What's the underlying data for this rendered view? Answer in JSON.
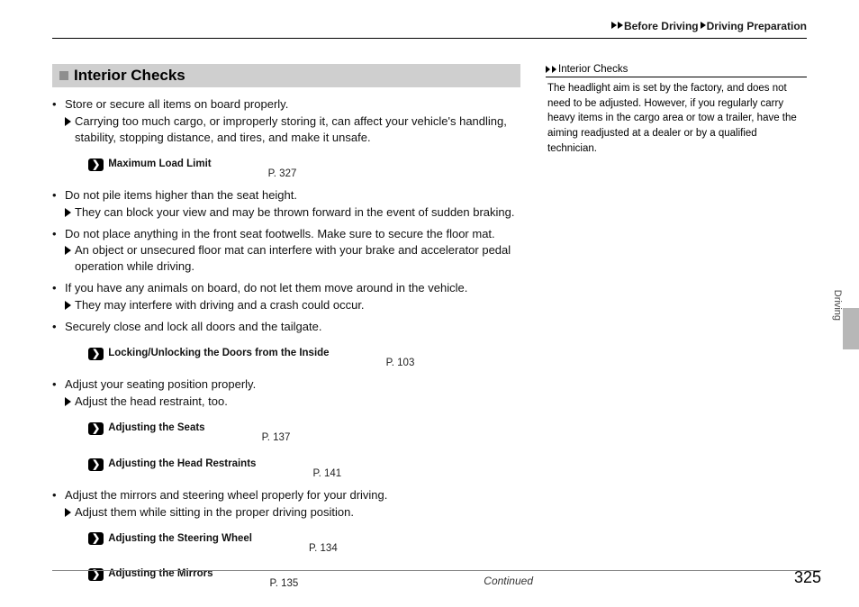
{
  "breadcrumb": {
    "a": "Before Driving",
    "b": "Driving Preparation"
  },
  "tabLabel": "Driving",
  "section": {
    "title": "Interior Checks"
  },
  "bullets": [
    {
      "text": "Store or secure all items on board properly.",
      "sub": "Carrying too much cargo, or improperly storing it, can affect your vehicle's handling, stability, stopping distance, and tires, and make it unsafe.",
      "xrefs": [
        {
          "title": "Maximum Load Limit",
          "page": "P. 327"
        }
      ]
    },
    {
      "text": "Do not pile items higher than the seat height.",
      "sub": "They can block your view and may be thrown forward in the event of sudden braking."
    },
    {
      "text": "Do not place anything in the front seat footwells. Make sure to secure the floor mat.",
      "sub": "An object or unsecured floor mat can interfere with your brake and accelerator pedal operation while driving."
    },
    {
      "text": "If you have any animals on board, do not let them move around in the vehicle.",
      "sub": "They may interfere with driving and a crash could occur."
    },
    {
      "text": "Securely close and lock all doors and the tailgate.",
      "xrefs": [
        {
          "title": "Locking/Unlocking the Doors from the Inside",
          "page": "P. 103"
        }
      ]
    },
    {
      "text": "Adjust your seating position properly.",
      "sub": "Adjust the head restraint, too.",
      "xrefs": [
        {
          "title": "Adjusting the Seats",
          "page": "P. 137"
        },
        {
          "title": "Adjusting the Head Restraints",
          "page": "P. 141"
        }
      ]
    },
    {
      "text": "Adjust the mirrors and steering wheel properly for your driving.",
      "sub": "Adjust them while sitting in the proper driving position.",
      "xrefs": [
        {
          "title": "Adjusting the Steering Wheel",
          "page": "P. 134"
        },
        {
          "title": "Adjusting the Mirrors",
          "page": "P. 135"
        }
      ]
    }
  ],
  "sideHead": "Interior Checks",
  "sideBody": "The headlight aim is set by the factory, and does not need to be adjusted. However, if you regularly carry heavy items in the cargo area or tow a trailer, have the aiming readjusted at a dealer or by a qualified technician.",
  "footer": {
    "continued": "Continued",
    "page": "325"
  }
}
